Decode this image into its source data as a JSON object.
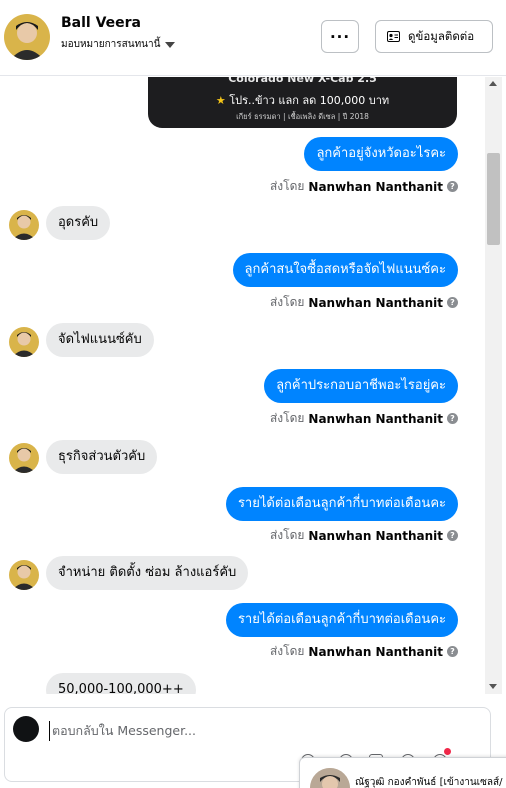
{
  "header": {
    "contact_name": "Ball Veera",
    "assign_label": "มอบหมายการสนทนานี้",
    "more_label": "···",
    "contact_info_label": "ดูข้อมูลติดต่อ"
  },
  "promo": {
    "title": "Colorado New X-Cab 2.5",
    "deal": "โปร..ข้าว แลก ลด 100,000 บาท",
    "spec": "เกียร์ ธรรมดา  |  เชื้อเพลิง ดีเซล  |  ปี 2018"
  },
  "sent_by_prefix": "ส่งโดย",
  "agent_name": "Nanwhan Nanthanit",
  "messages": {
    "out_1": "ลูกค้าอยู่จังหวัดอะไรคะ",
    "in_1": "อุดรคับ",
    "out_2": "ลูกค้าสนใจซื้อสดหรือจัดไฟแนนซ์คะ",
    "in_2": "จัดไฟแนนซ์คับ",
    "out_3": "ลูกค้าประกอบอาชีพอะไรอยู่คะ",
    "in_3": "ธุรกิจส่วนตัวคับ",
    "out_4": "รายได้ต่อเดือนลูกค้ากี่บาทต่อเดือนคะ",
    "in_4": "จำหน่าย ติดตั้ง ซ่อม ล้างแอร์คับ",
    "out_5": "รายได้ต่อเดือนลูกค้ากี่บาทต่อเดือนคะ",
    "in_5": "50,000-100,000++"
  },
  "composer": {
    "placeholder": "ตอบกลับใน Messenger..."
  },
  "chat_tab": {
    "name": "ณัฐวุฒิ กองคำพันธ์ [เข้างานเซลส์/"
  },
  "colors": {
    "outgoing_bubble": "#0084ff",
    "incoming_bubble": "#e9eaeb"
  }
}
